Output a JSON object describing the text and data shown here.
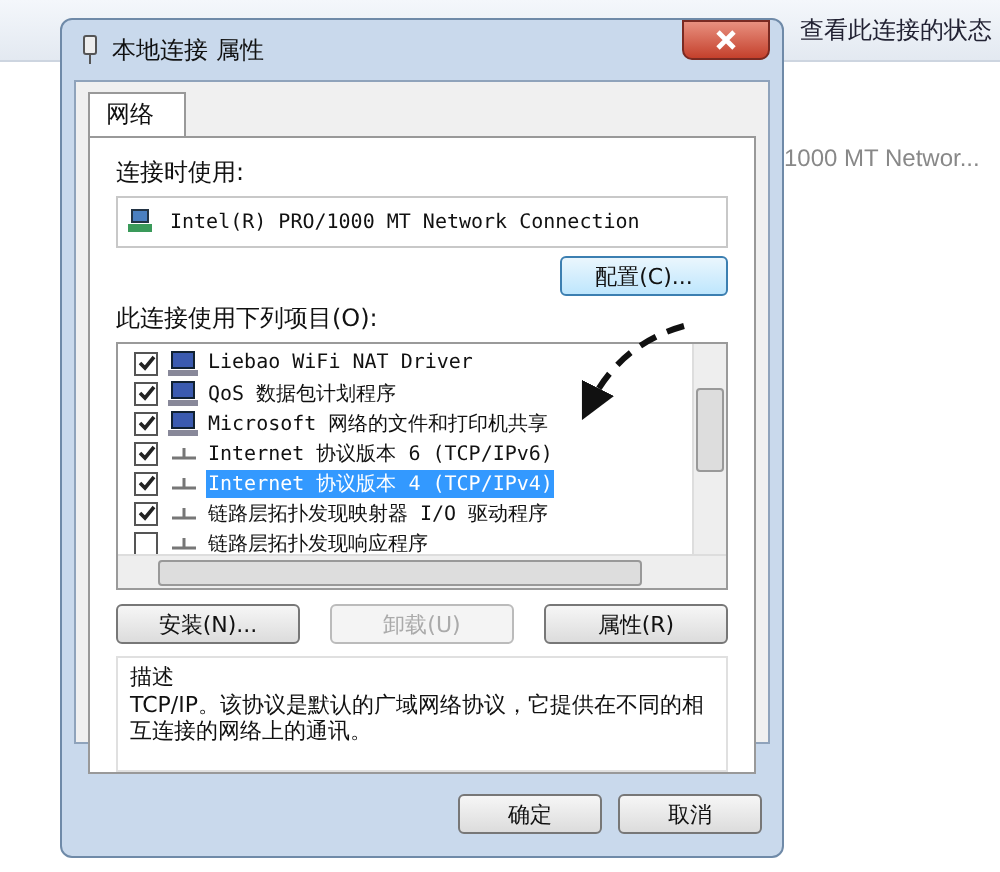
{
  "background_window": {
    "toolbar_text": "查看此连接的状态",
    "adapter_text": "1000 MT Networ..."
  },
  "dialog": {
    "title": "本地连接 属性",
    "tabs": [
      {
        "label": "网络",
        "selected": true
      }
    ],
    "connect_using_label": "连接时使用:",
    "adapter": "Intel(R) PRO/1000 MT Network Connection",
    "configure_button": "配置(C)...",
    "items_label": "此连接使用下列项目(O):",
    "items": [
      {
        "label": "Liebao WiFi NAT Driver",
        "checked": true,
        "selected": false,
        "kind": "client"
      },
      {
        "label": "QoS 数据包计划程序",
        "checked": true,
        "selected": false,
        "kind": "client"
      },
      {
        "label": "Microsoft 网络的文件和打印机共享",
        "checked": true,
        "selected": false,
        "kind": "client"
      },
      {
        "label": "Internet 协议版本 6 (TCP/IPv6)",
        "checked": true,
        "selected": false,
        "kind": "protocol"
      },
      {
        "label": "Internet 协议版本 4 (TCP/IPv4)",
        "checked": true,
        "selected": true,
        "kind": "protocol"
      },
      {
        "label": "链路层拓扑发现映射器 I/O 驱动程序",
        "checked": true,
        "selected": false,
        "kind": "protocol"
      },
      {
        "label": "链路层拓扑发现响应程序",
        "checked": false,
        "selected": false,
        "kind": "protocol"
      }
    ],
    "buttons": [
      {
        "label": "安装(N)...",
        "disabled": false
      },
      {
        "label": "卸载(U)",
        "disabled": true
      },
      {
        "label": "属性(R)",
        "disabled": false
      }
    ],
    "description": {
      "title": "描述",
      "text": "TCP/IP。该协议是默认的广域网络协议，它提供在不同的相互连接的网络上的通讯。"
    },
    "dialog_buttons": [
      "确定",
      "取消"
    ]
  }
}
